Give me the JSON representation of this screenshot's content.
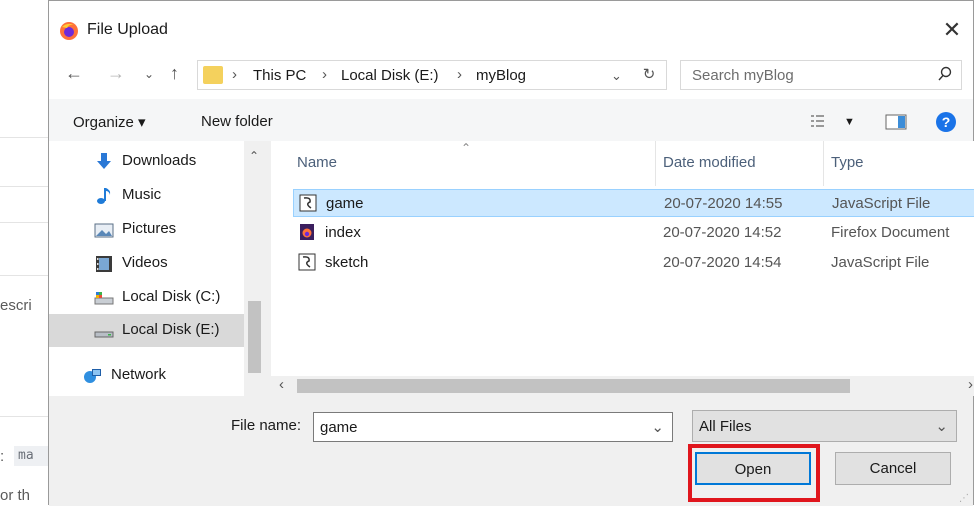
{
  "background": {
    "text_1": "escri",
    "code": "ma",
    "text_2": "or th",
    "prefix": ":"
  },
  "dialog": {
    "title": "File Upload",
    "close": "✕",
    "address": {
      "crumbs": [
        "This PC",
        "Local Disk (E:)",
        "myBlog"
      ]
    },
    "search_placeholder": "Search myBlog",
    "toolbar": {
      "organize": "Organize ▾",
      "new_folder": "New folder",
      "help": "?"
    },
    "nav_items": [
      {
        "label": "Downloads",
        "icon": "download-icon"
      },
      {
        "label": "Music",
        "icon": "music-icon"
      },
      {
        "label": "Pictures",
        "icon": "pictures-icon"
      },
      {
        "label": "Videos",
        "icon": "videos-icon"
      },
      {
        "label": "Local Disk (C:)",
        "icon": "drive-icon"
      },
      {
        "label": "Local Disk (E:)",
        "icon": "drive-icon",
        "selected": true
      },
      {
        "label": "Network",
        "icon": "network-icon"
      }
    ],
    "columns": [
      "Name",
      "Date modified",
      "Type"
    ],
    "files": [
      {
        "name": "game",
        "date": "20-07-2020 14:55",
        "type": "JavaScript File",
        "selected": true
      },
      {
        "name": "index",
        "date": "20-07-2020 14:52",
        "type": "Firefox Document"
      },
      {
        "name": "sketch",
        "date": "20-07-2020 14:54",
        "type": "JavaScript File"
      }
    ],
    "file_name_label": "File name:",
    "file_name_value": "game",
    "filter_value": "All Files",
    "open_label": "Open",
    "cancel_label": "Cancel"
  },
  "colors": {
    "accent": "#0078d7",
    "selection": "#cce8ff",
    "highlight_box": "#e0161d"
  }
}
